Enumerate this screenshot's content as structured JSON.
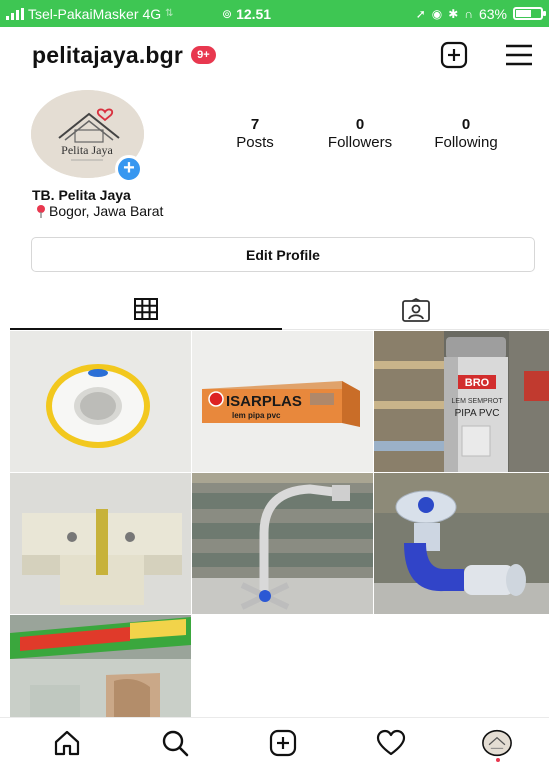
{
  "status_bar": {
    "carrier": "Tsel-PakaiMasker",
    "network": "4G",
    "time": "12.51",
    "battery": "63%",
    "battery_level": 0.63
  },
  "header": {
    "username": "pelitajaya.bgr",
    "notification_badge": "9+"
  },
  "avatar": {
    "logo_text": "Pelita Jaya"
  },
  "stats": {
    "posts": {
      "value": "7",
      "label": "Posts"
    },
    "followers": {
      "value": "0",
      "label": "Followers"
    },
    "following": {
      "value": "0",
      "label": "Following"
    }
  },
  "profile": {
    "display_name": "TB. Pelita Jaya",
    "location": "Bogor, Jawa Barat"
  },
  "edit_profile_label": "Edit Profile",
  "posts": {
    "post2_text": "ISARPLAS",
    "post2_sub": "lem pipa pvc",
    "post3_brand": "BRO",
    "post3_text": "LEM SEMPROT",
    "post3_sub": "PIPA PVC"
  },
  "colors": {
    "status_bar": "#3ec653",
    "badge": "#e8384f",
    "accent_blue": "#3797f0"
  }
}
